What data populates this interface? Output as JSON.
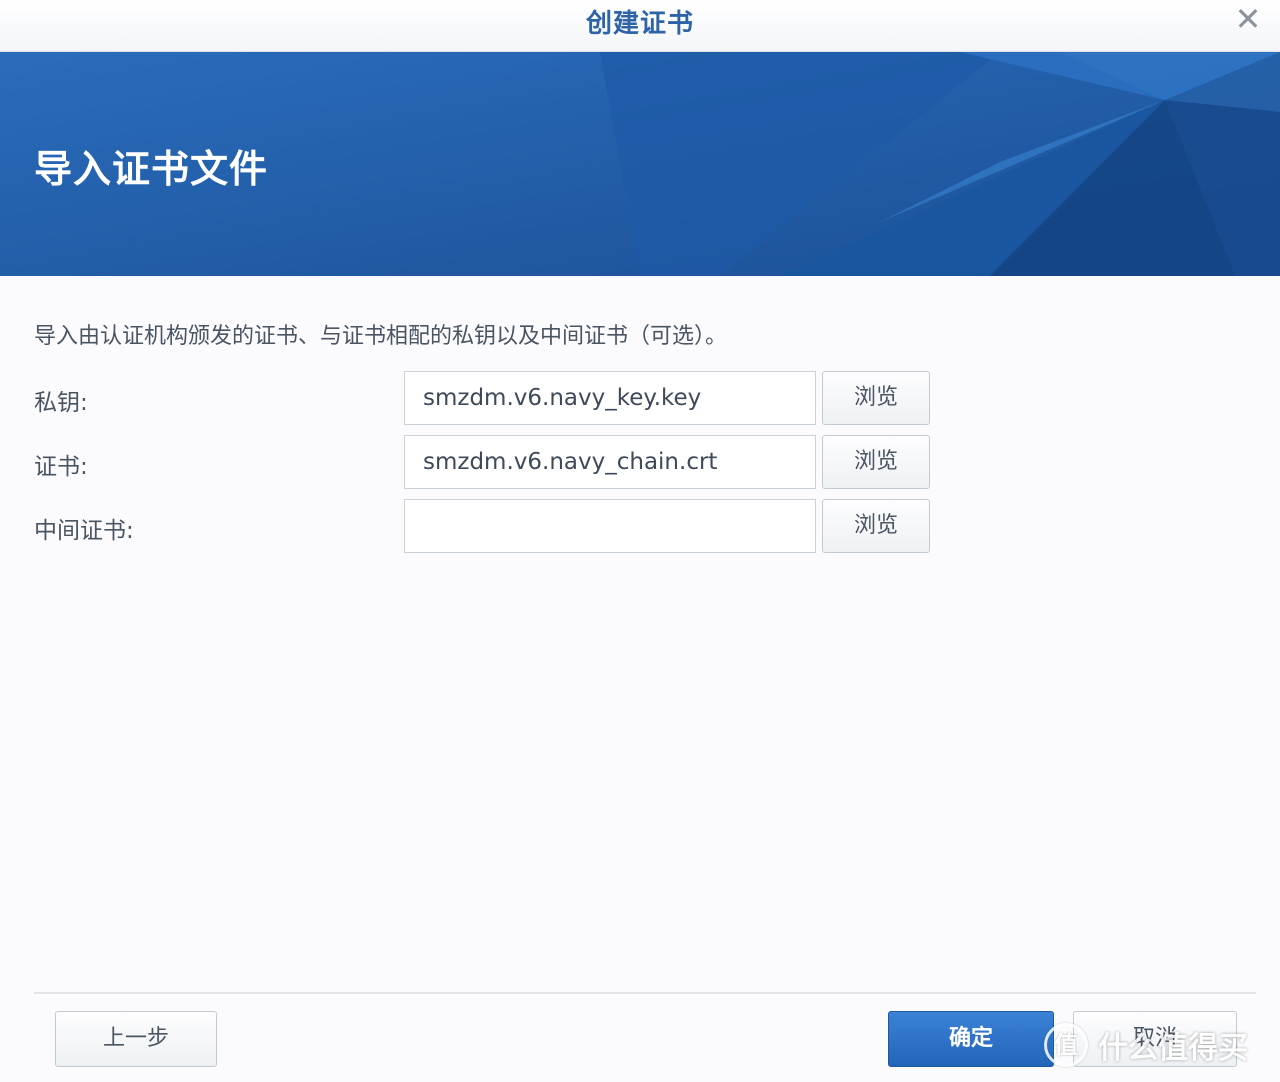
{
  "window": {
    "title": "创建证书",
    "close_glyph": "✕"
  },
  "banner": {
    "heading": "导入证书文件"
  },
  "description": "导入由认证机构颁发的证书、与证书相配的私钥以及中间证书（可选）。",
  "fields": [
    {
      "label": "私钥:",
      "value": "smzdm.v6.navy_key.key",
      "browse_label": "浏览"
    },
    {
      "label": "证书:",
      "value": "smzdm.v6.navy_chain.crt",
      "browse_label": "浏览"
    },
    {
      "label": "中间证书:",
      "value": "",
      "browse_label": "浏览"
    }
  ],
  "footer": {
    "back_label": "上一步",
    "ok_label": "确定",
    "cancel_label": "取消"
  },
  "watermark": {
    "logo_glyph": "值",
    "text": "什么值得买"
  },
  "colors": {
    "accent": "#2265b9",
    "banner": "#1f5ba3",
    "title": "#2f63a8"
  }
}
